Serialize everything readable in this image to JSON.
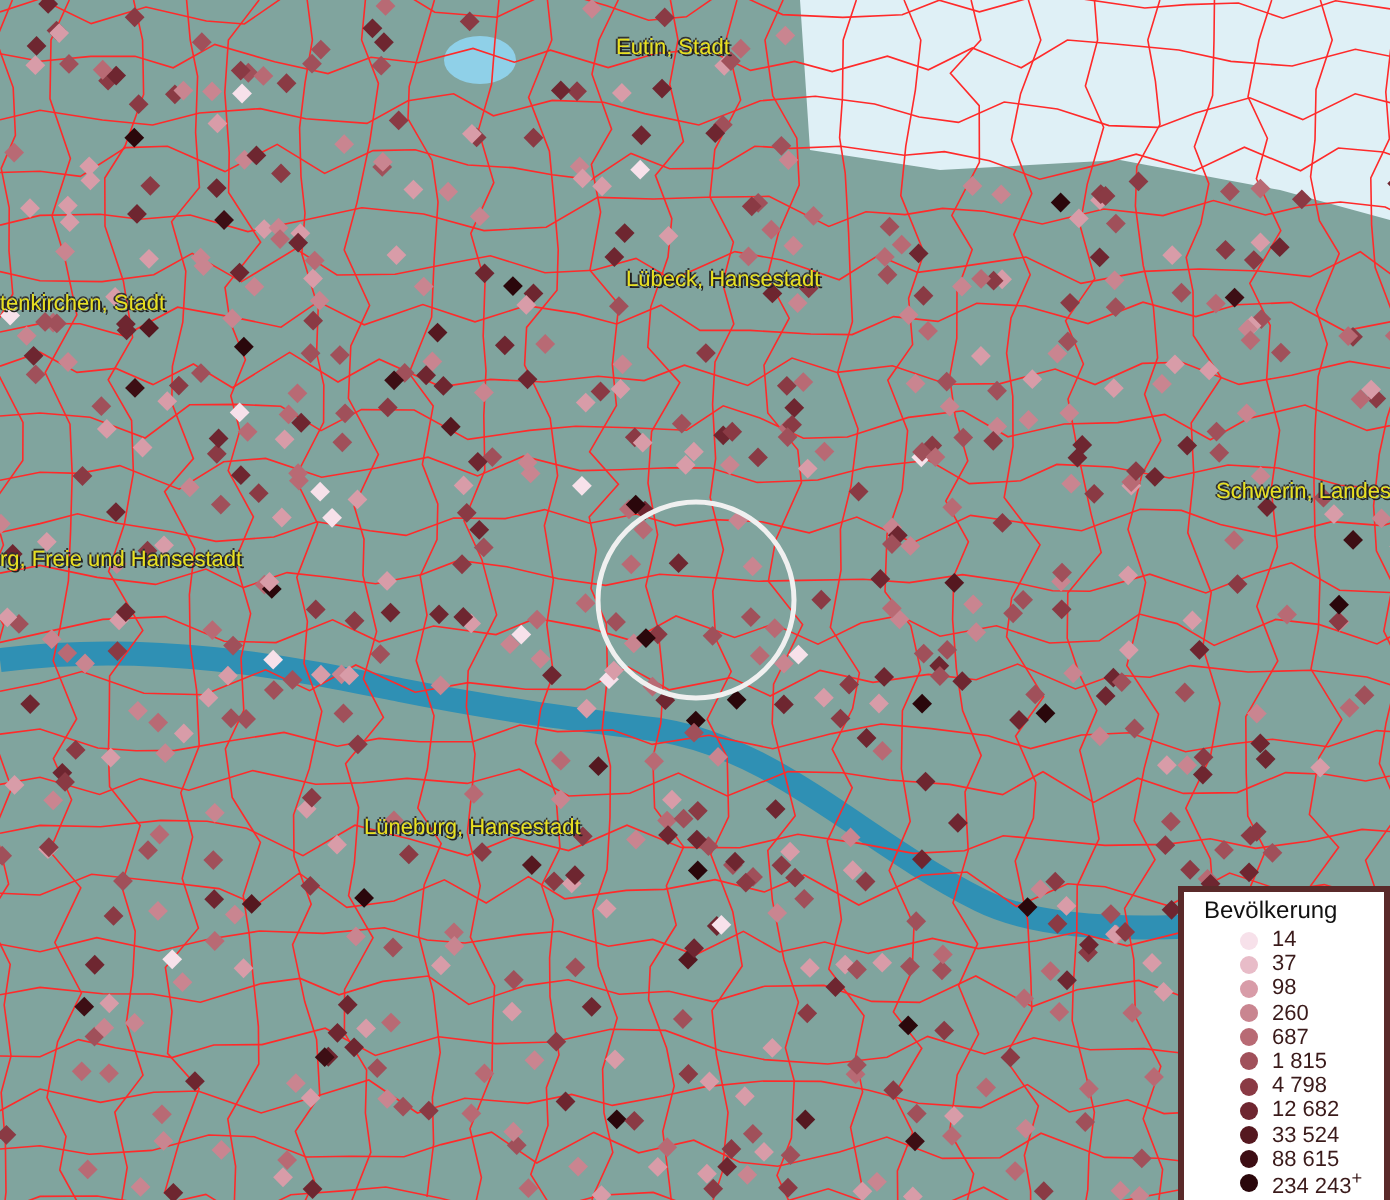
{
  "map_labels": [
    {
      "text": "Eutin, Stadt"
    },
    {
      "text": "Lübeck, Hansestadt"
    },
    {
      "text": "tenkirchen, Stadt"
    },
    {
      "text": "Schwerin, Landes"
    },
    {
      "text": "rg, Freie und Hansestadt"
    },
    {
      "text": "Lüneburg, Hansestadt"
    }
  ],
  "legend": {
    "title": "Bevölkerung",
    "classes": [
      {
        "label": "14",
        "color": "#f7e1ea"
      },
      {
        "label": "37",
        "color": "#e8bcc8"
      },
      {
        "label": "98",
        "color": "#d89ca8"
      },
      {
        "label": "260",
        "color": "#c98590"
      },
      {
        "label": "687",
        "color": "#b86a74"
      },
      {
        "label": "1 815",
        "color": "#a0505a"
      },
      {
        "label": "4 798",
        "color": "#8a3a44"
      },
      {
        "label": "12 682",
        "color": "#6e2630"
      },
      {
        "label": "33 524",
        "color": "#551820"
      },
      {
        "label": "88 615",
        "color": "#3d0e14"
      },
      {
        "label": "234 243$^{+}$",
        "color": "#2a070b"
      }
    ]
  }
}
